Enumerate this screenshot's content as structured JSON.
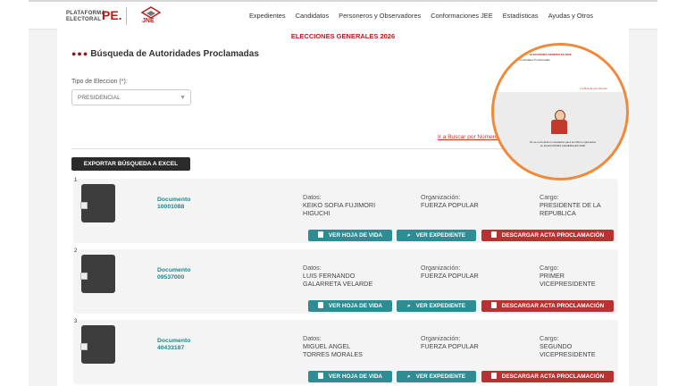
{
  "header": {
    "logo_pe_text": [
      "PLATAFORMA",
      "ELECTORAL"
    ],
    "logo_pe_mark": "PE.",
    "logo_jne_text": "JNE",
    "nav": [
      "Expedientes",
      "Candidatos",
      "Personeros y Observadores",
      "Conformaciones JEE",
      "Estadísticas",
      "Ayudas y Otros"
    ]
  },
  "banner": "ELECCIONES GENERALES 2026",
  "page_title": "Búsqueda de Autoridades Proclamadas",
  "tipo_eleccion": {
    "label": "Tipo de Eleccion (*):",
    "selected": "PRESIDENCIAL"
  },
  "buscar_link": "Ir a Buscar por Número",
  "export_button": "EXPORTAR BÚSQUEDA A EXCEL",
  "labels": {
    "documento": "Documento",
    "datos": "Datos:",
    "organizacion": "Organización:",
    "cargo": "Cargo:"
  },
  "buttons": {
    "hoja": "VER HOJA DE VIDA",
    "expediente": "VER EXPEDIENTE",
    "acta": "DESCARGAR ACTA PROCLAMACIÓN"
  },
  "results": [
    {
      "num": "1",
      "doc": "10001088",
      "datos": [
        "KEIKO SOFIA FUJIMORI",
        "HIGUCHI"
      ],
      "org": "FUERZA POPULAR",
      "cargo": [
        "PRESIDENTE DE LA",
        "REPUBLICA"
      ]
    },
    {
      "num": "2",
      "doc": "09537000",
      "datos": [
        "LUIS FERNANDO",
        "GALARRETA VELARDE"
      ],
      "org": "FUERZA POPULAR",
      "cargo": [
        "PRIMER",
        "VICEPRESIDENTE"
      ]
    },
    {
      "num": "3",
      "doc": "40433187",
      "datos": [
        "MIGUEL ANGEL",
        "TORRES MORALES"
      ],
      "org": "FUERZA POPULAR",
      "cargo": [
        "SEGUNDO",
        "VICEPRESIDENTE"
      ]
    }
  ],
  "zoom": {
    "title": "ELECCIONES GENERALES 2026",
    "message": "No se encontraron resultados para los filtros ingresados en ELECCIONES GENERALES 2026"
  },
  "colors": {
    "accent_red": "#b71c1c",
    "teal": "#2e8c93",
    "button_red": "#b83232",
    "zoom_ring": "#f08a3a"
  }
}
